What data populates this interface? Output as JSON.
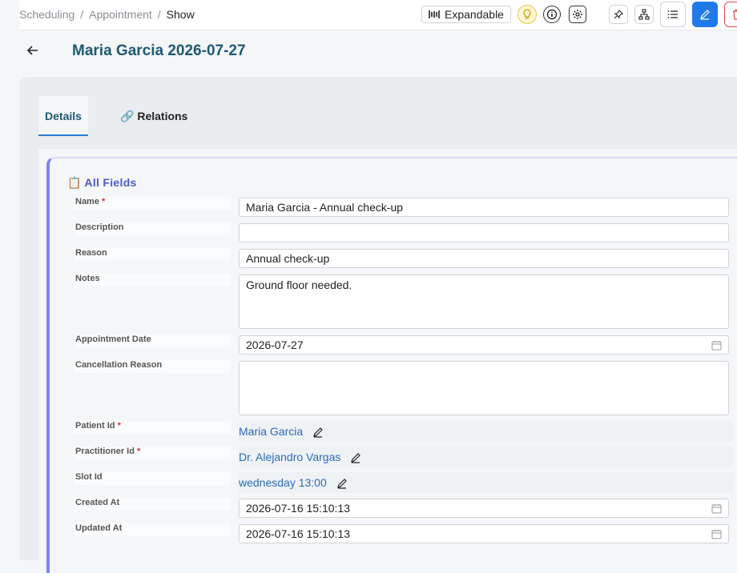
{
  "breadcrumb": [
    "Scheduling",
    "Appointment",
    "Show"
  ],
  "toolbar": {
    "expand_label": "Expandable"
  },
  "page": {
    "title": "Maria Garcia 2026-07-27"
  },
  "tabs": {
    "details": "Details",
    "relations": "Relations"
  },
  "section": {
    "title": "All Fields"
  },
  "fields": {
    "name": {
      "label": "Name",
      "value": "Maria Garcia - Annual check-up",
      "required": "*"
    },
    "description": {
      "label": "Description",
      "value": ""
    },
    "reason": {
      "label": "Reason",
      "value": "Annual check-up"
    },
    "notes": {
      "label": "Notes",
      "value": "Ground floor needed."
    },
    "appointment_date": {
      "label": "Appointment Date",
      "value": "2026-07-27"
    },
    "cancellation_reason": {
      "label": "Cancellation Reason",
      "value": ""
    },
    "patient_id": {
      "label": "Patient Id",
      "value": "Maria Garcia",
      "required": "*"
    },
    "practitioner_id": {
      "label": "Practitioner Id",
      "value": "Dr. Alejandro Vargas",
      "required": "*"
    },
    "slot_id": {
      "label": "Slot Id",
      "value": "wednesday 13:00"
    },
    "created_at": {
      "label": "Created At",
      "value": "2026-07-16 15:10:13"
    },
    "updated_at": {
      "label": "Updated At",
      "value": "2026-07-16 15:10:13"
    }
  },
  "colors": {
    "title": "#1e5a72",
    "accent": "#1e7ae6",
    "section": "#4d5ac9",
    "link": "#2a6bb8",
    "danger": "#e04848"
  }
}
